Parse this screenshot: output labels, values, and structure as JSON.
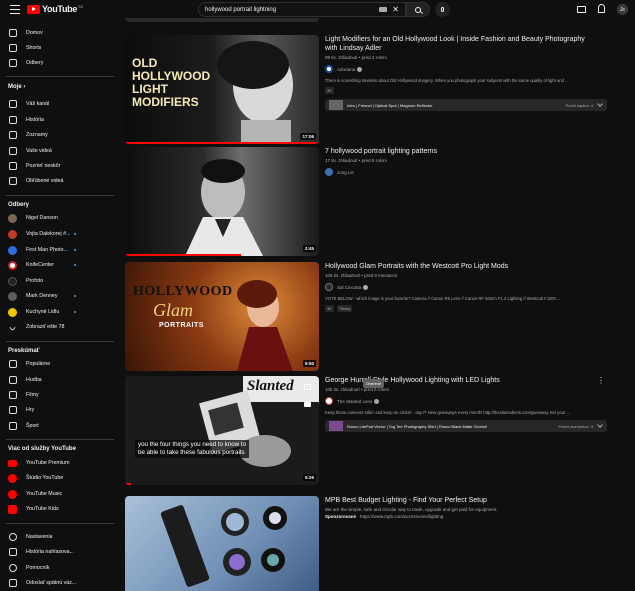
{
  "header": {
    "logo_text": "YouTube",
    "logo_cc": "SK",
    "search_query": "hollywood portrait lightning",
    "clear_symbol": "✕",
    "avatar_initial": "Jc"
  },
  "sidebar": {
    "main": [
      {
        "label": "Domov",
        "icon": "home-icon"
      },
      {
        "label": "Shorts",
        "icon": "shorts-icon"
      },
      {
        "label": "Odbery",
        "icon": "subscriptions-icon"
      }
    ],
    "moje_heading": "Moje  ›",
    "moje": [
      {
        "label": "Váš kanál",
        "icon": "channel-icon"
      },
      {
        "label": "História",
        "icon": "history-icon"
      },
      {
        "label": "Zoznamy",
        "icon": "playlists-icon"
      },
      {
        "label": "Vaše videá",
        "icon": "your-videos-icon"
      },
      {
        "label": "Pozrieť neskôr",
        "icon": "watch-later-icon"
      },
      {
        "label": "Obľúbené videá",
        "icon": "liked-icon"
      }
    ],
    "subs_heading": "Odbery",
    "subs": [
      {
        "label": "Nigel Danson",
        "color": "#7a6a55",
        "dot": false
      },
      {
        "label": "Vojta Dalekorej #...",
        "color": "#c0392b",
        "dot": true
      },
      {
        "label": "First Man Photo...",
        "color": "#2d6cdf",
        "dot": true
      },
      {
        "label": "KnifeCenter",
        "color": "#c62828",
        "dot": true
      },
      {
        "label": "Profoto",
        "color": "#222222",
        "dot": false
      },
      {
        "label": "Mark Denney",
        "color": "#5d5d5d",
        "dot": true
      },
      {
        "label": "Kuchyně Lidlu",
        "color": "#f5c400",
        "dot": true
      },
      {
        "label": "Zobraziť ešte 78",
        "color": "",
        "dot": false
      }
    ],
    "explore_heading": "Preskúmať",
    "explore": [
      {
        "label": "Populárne",
        "icon": "trending-icon"
      },
      {
        "label": "Hudba",
        "icon": "music-icon"
      },
      {
        "label": "Filmy",
        "icon": "movies-icon"
      },
      {
        "label": "Hry",
        "icon": "gaming-icon"
      },
      {
        "label": "Šport",
        "icon": "sports-icon"
      }
    ],
    "more_heading": "Viac od služby YouTube",
    "more": [
      {
        "label": "YouTube Premium"
      },
      {
        "label": "Štúdio YouTube"
      },
      {
        "label": "YouTube Music"
      },
      {
        "label": "YouTube Kids"
      }
    ],
    "bottom": [
      {
        "label": "Nastavenia",
        "icon": "settings-icon"
      },
      {
        "label": "História nahlasova...",
        "icon": "report-icon"
      },
      {
        "label": "Pomocník",
        "icon": "help-icon"
      },
      {
        "label": "Odoslať spätnú väz...",
        "icon": "feedback-icon"
      }
    ]
  },
  "results": [
    {
      "title_1": "Light Modifiers for an Old Hollywood Look | Inside Fashion and Beauty Photography",
      "title_2": "with Lindsay Adler",
      "meta": "99 tis. zhliadnutí • pred 2 rokmi",
      "channel": "Adorama",
      "desc": "There is something timeless about Old Hollywood imagery. When you photograph your subjects with the same quality of light and ...",
      "tags": [
        "4K"
      ],
      "chapters_text": "Intro | Fresnel | Optical Spot | Magnum Reflector",
      "chapters_right": "Počet kapitol: 4",
      "duration": "17:06",
      "thumb_text": "OLD HOLLYWOOD LIGHT MODIFIERS",
      "progress": 1.0
    },
    {
      "title_1": "7 hollywood portrait lighting patterns",
      "meta": "17 tis. zhliadnutí • pred 8 rokmi",
      "channel": "Jong Lin",
      "duration": "3:45",
      "progress": 0.6
    },
    {
      "title_1": "Hollywood Glam Portraits with the Westcott Pro Light Mods",
      "meta": "106 tis. zhliadnutí • pred 9 mesiacmi",
      "channel": "Sal Cincotta",
      "desc": "VOTE BELOW - which image is your favorite? Camera // Canon R5 Lens // Canon RF 50mm F1.2 Lighting // Westcott FJ200 ...",
      "tags": [
        "4K",
        "Titulky"
      ],
      "duration": "6:50",
      "thumb_line1": "HOLLYWOOD",
      "thumb_line2": "Glam",
      "thumb_line3": "PORTRAITS"
    },
    {
      "title_1": "George Hurrell Style Hollywood Lighting with LED Lights",
      "meta": "10k tis. zhliadnutí • pred 5 rokmi",
      "channel": "The Slanted Lens",
      "desc": "Keep those cameras rollin' and keep on clickin'. -Jay P. New giveaways every month! http://theslantedlens.com/giveaway Set your ...",
      "chapters_text": "Rosco LitePad Vector | Tog Tee Photography Shirt | Rosco Black Matte Cinefoil",
      "chapters_right": "Počet momentov: 3",
      "duration": "5:26",
      "tooltip": "Overené",
      "caption_1": "you the four things you need to know to",
      "caption_2": "be able to take these fabulous portraits",
      "thumb_sign": "Slanted"
    },
    {
      "title_1": "MPB Best Budget Lighting - Find Your Perfect Setup",
      "desc": "We are the simple, safe and circular way to trade, upgrade and get paid for equipment.",
      "ad_label": "Sponzorované",
      "ad_url": "https://www.mpb.com/accessories/lighting"
    }
  ]
}
